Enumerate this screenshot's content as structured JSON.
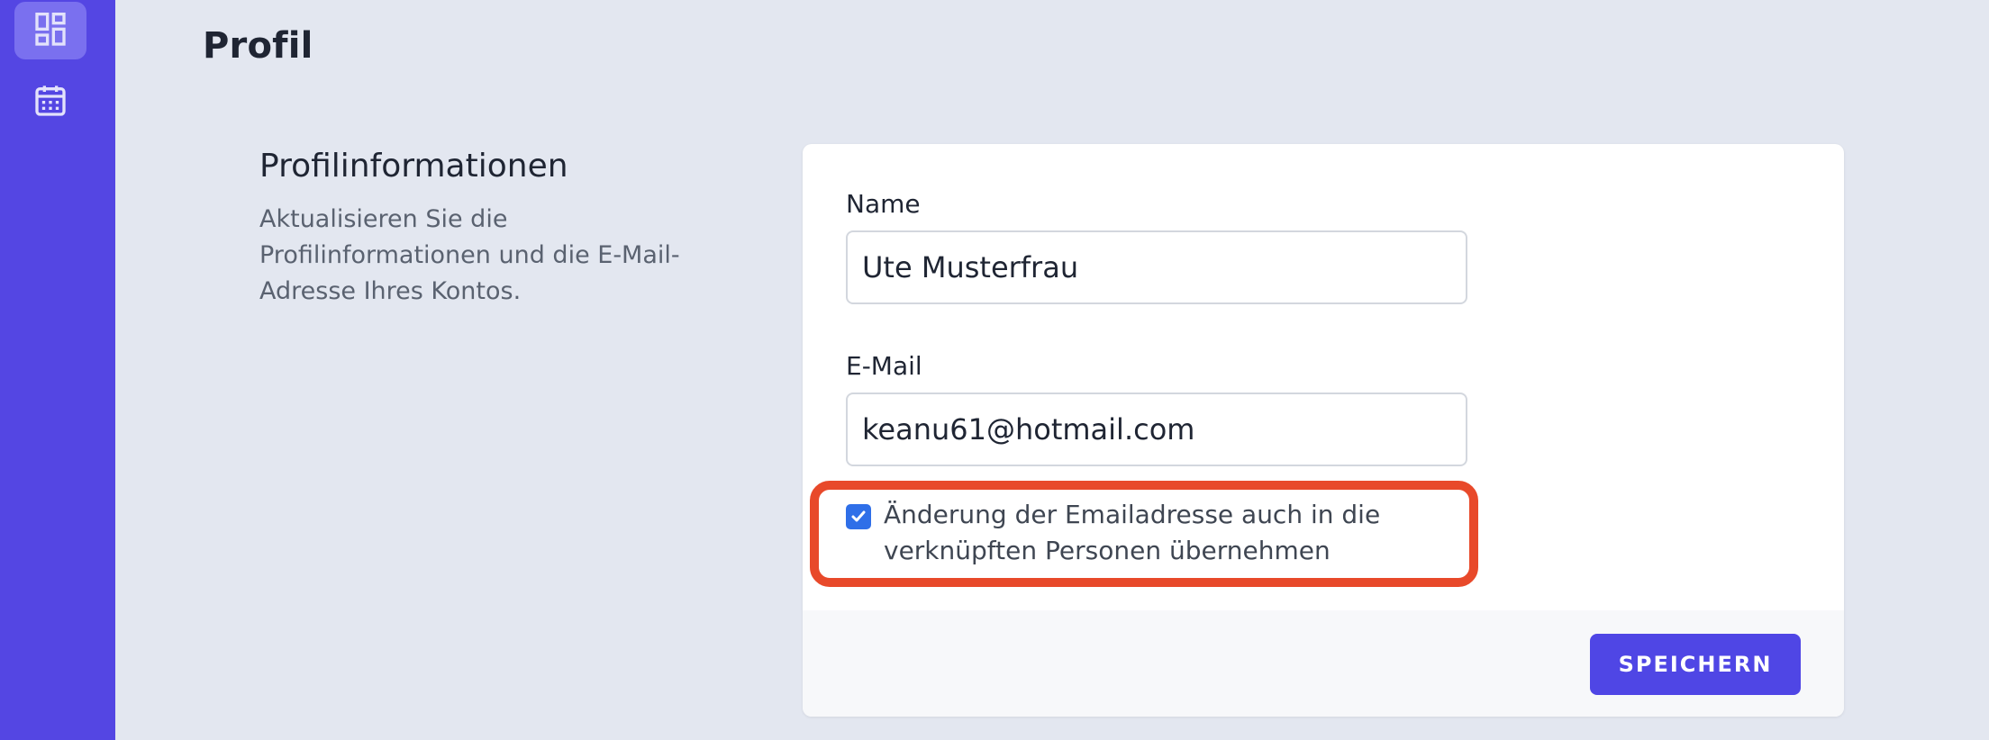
{
  "colors": {
    "sidebar": "#5446e3",
    "background": "#e3e7f0",
    "accent": "#4f46e5",
    "highlight": "#e8492a",
    "checkbox": "#2f6fe8"
  },
  "sidebar": {
    "items": [
      {
        "icon": "dashboard-icon",
        "active": true
      },
      {
        "icon": "calendar-icon",
        "active": false
      }
    ]
  },
  "page": {
    "title": "Profil"
  },
  "section": {
    "heading": "Profilinformationen",
    "description": "Aktualisieren Sie die Profilinformationen und die E-Mail-Adresse Ihres Kontos."
  },
  "form": {
    "name_label": "Name",
    "name_value": "Ute Musterfrau",
    "email_label": "E-Mail",
    "email_value": "keanu61@hotmail.com",
    "checkbox_label": "Änderung der Emailadresse auch in die verknüpften Personen übernehmen",
    "checkbox_checked": true,
    "save_label": "SPEICHERN"
  }
}
